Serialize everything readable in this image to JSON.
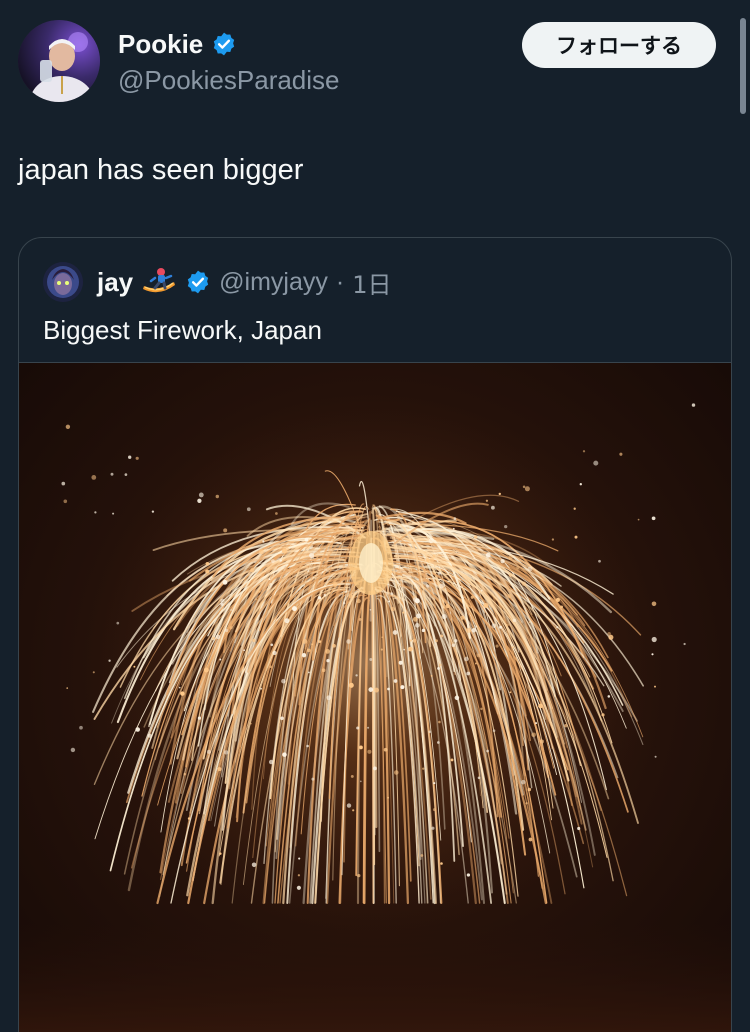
{
  "tweet": {
    "author": {
      "display_name": "Pookie",
      "handle": "@PookiesParadise",
      "verified": true,
      "avatar_icon": "profile-photo"
    },
    "follow_button_label": "フォローする",
    "text": "japan has seen bigger"
  },
  "quoted_tweet": {
    "author": {
      "display_name": "jay",
      "emoji_icon": "snowboarder-emoji",
      "handle": "@imyjayy",
      "verified": true
    },
    "separator": "·",
    "time": "1日",
    "text": "Biggest Firework, Japan",
    "media": {
      "type": "image",
      "description_icon": "firework-image"
    }
  },
  "colors": {
    "background": "#15202b",
    "text_primary": "#f7f9f9",
    "text_secondary": "#8b98a5",
    "border": "#38444d",
    "verified_blue": "#1d9bf0",
    "follow_button_bg": "#eff3f4"
  }
}
